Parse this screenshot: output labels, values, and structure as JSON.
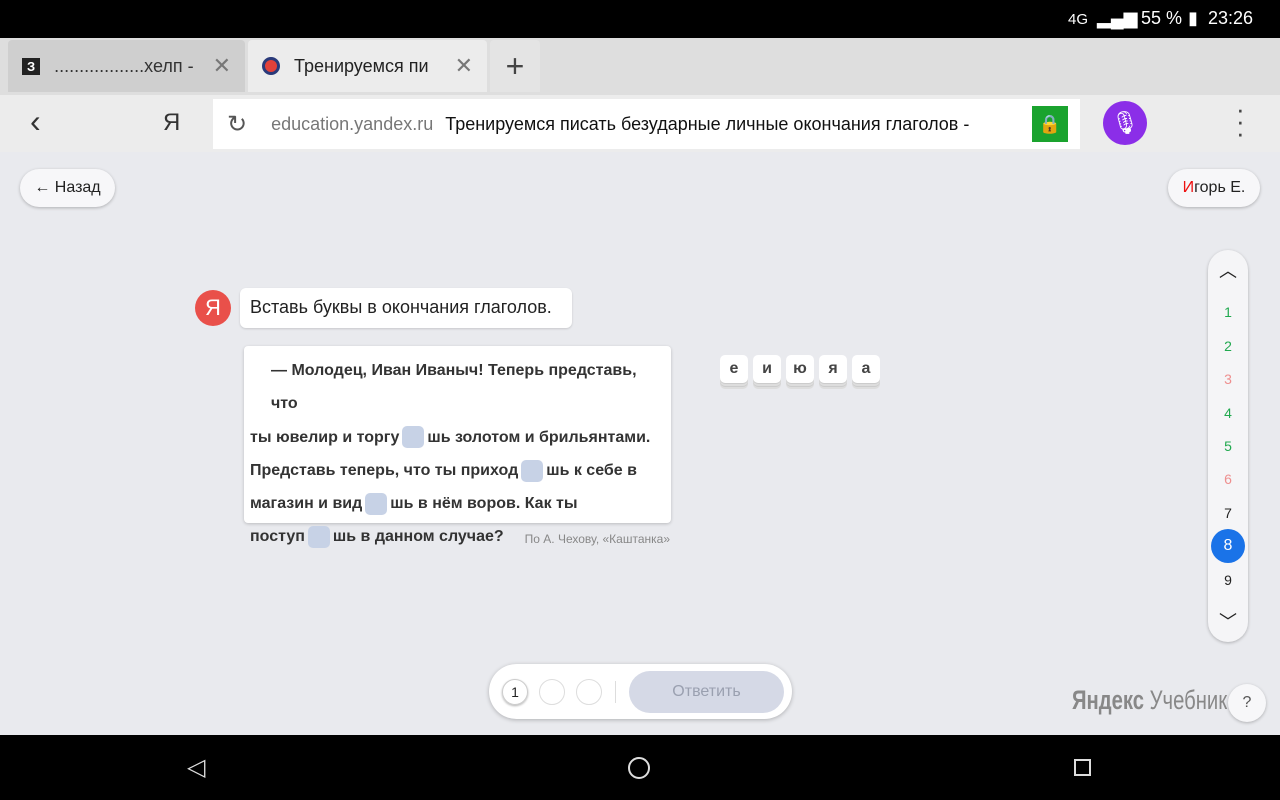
{
  "status": {
    "network": "4G",
    "battery": "55 %",
    "time": "23:26"
  },
  "tabs": [
    {
      "icon": "З",
      "title": "..................хелп -"
    },
    {
      "title": "Тренируемся пи"
    }
  ],
  "address": {
    "host": "education.yandex.ru",
    "title": "Тренируемся писать безударные личные окончания глаголов -",
    "logo": "Я"
  },
  "page": {
    "back_label": "← Назад",
    "user": {
      "initial": "И",
      "rest": "горь Е."
    },
    "avatar": "Я",
    "instruction": "Вставь буквы в окончания глаголов.",
    "text": [
      "— Молодец, Иван Иваныч! Теперь представь, что",
      "ты ювелир и торгу",
      "шь золотом и брильянтами.",
      "Представь теперь, что ты приход",
      "шь к себе в",
      "магазин и вид",
      "шь в нём воров. Как ты",
      "поступ",
      "шь в данном случае?"
    ],
    "source": "По А. Чехову, «Каштанка»",
    "letters": [
      "е",
      "и",
      "ю",
      "я",
      "а"
    ],
    "pages": [
      {
        "n": "1",
        "state": "correct"
      },
      {
        "n": "2",
        "state": "correct"
      },
      {
        "n": "3",
        "state": "wrong"
      },
      {
        "n": "4",
        "state": "correct"
      },
      {
        "n": "5",
        "state": "correct"
      },
      {
        "n": "6",
        "state": "wrong"
      },
      {
        "n": "7",
        "state": "none"
      },
      {
        "n": "8",
        "state": "current"
      },
      {
        "n": "9",
        "state": "none"
      }
    ],
    "attempt": "1",
    "answer_label": "Ответить",
    "brand": {
      "a": "Яндекс",
      "b": "Учебник"
    },
    "help": "?"
  },
  "colors": {
    "correct": "#21a94f",
    "wrong": "#ee8f8f",
    "current": "#1a73e8"
  }
}
